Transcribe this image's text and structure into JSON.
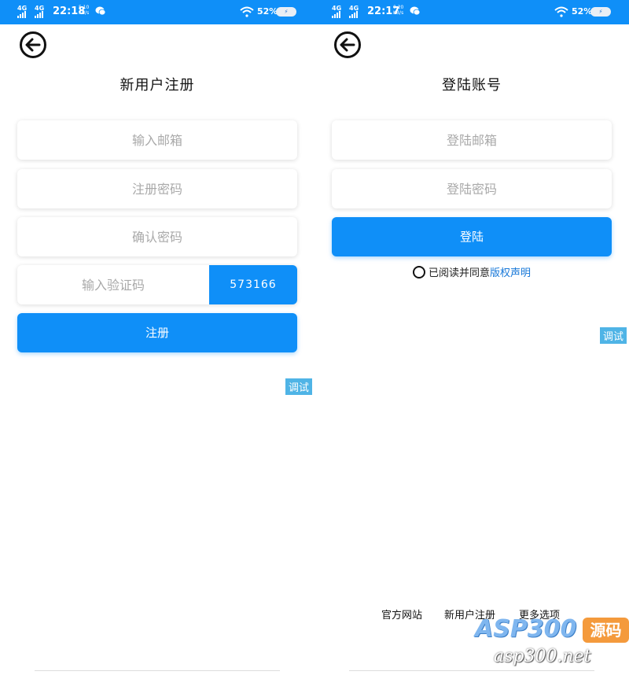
{
  "colors": {
    "primary": "#0f8ff8",
    "debug": "#4fb4e6",
    "link": "#1677d8",
    "watermark_badge": "#f49a3c"
  },
  "register": {
    "status": {
      "net1": "4G",
      "net2": "4G",
      "time": "22:18",
      "speed_value": "5.10",
      "speed_unit": "KB/s",
      "battery": "52%"
    },
    "title": "新用户注册",
    "email_placeholder": "输入邮箱",
    "password_placeholder": "注册密码",
    "confirm_placeholder": "确认密码",
    "captcha_placeholder": "输入验证码",
    "captcha_code": "573166",
    "submit_label": "注册",
    "debug_label": "调试"
  },
  "login": {
    "status": {
      "net1": "4G",
      "net2": "4G",
      "time": "22:17",
      "speed_value": "0.20",
      "speed_unit": "KB/s",
      "battery": "52%"
    },
    "title": "登陆账号",
    "email_placeholder": "登陆邮箱",
    "password_placeholder": "登陆密码",
    "submit_label": "登陆",
    "agree_text": "已阅读并同意",
    "agree_link": "版权声明",
    "debug_label": "调试",
    "footer": {
      "official_site": "官方网站",
      "new_register": "新用户注册",
      "more_options": "更多选项"
    }
  },
  "watermark": {
    "brand": "ASP300",
    "badge": "源码",
    "domain": "asp300.net"
  }
}
